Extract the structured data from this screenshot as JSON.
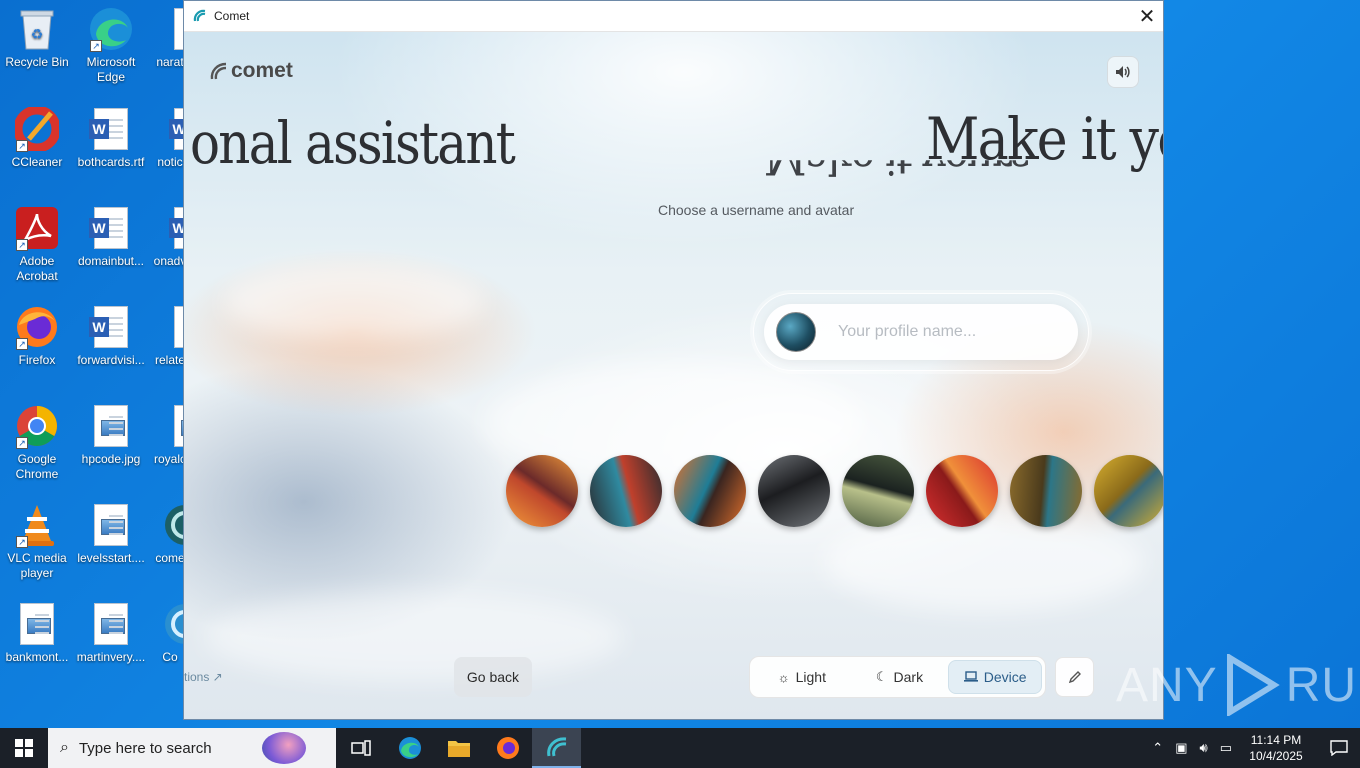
{
  "desktop": {
    "icons": [
      {
        "label": "Recycle Bin",
        "icon": "recycle-bin-icon"
      },
      {
        "label": "Microsoft Edge",
        "icon": "edge-icon"
      },
      {
        "label": "narat",
        "icon": "document-icon"
      },
      {
        "label": "CCleaner",
        "icon": "ccleaner-icon"
      },
      {
        "label": "bothcards.rtf",
        "icon": "word-document-icon"
      },
      {
        "label": "notic",
        "icon": "word-document-icon"
      },
      {
        "label": "Adobe Acrobat",
        "icon": "acrobat-icon"
      },
      {
        "label": "domainbut...",
        "icon": "word-document-icon"
      },
      {
        "label": "onadv",
        "icon": "word-document-icon"
      },
      {
        "label": "Firefox",
        "icon": "firefox-icon"
      },
      {
        "label": "forwardvisi...",
        "icon": "word-document-icon"
      },
      {
        "label": "relate",
        "icon": "document-icon"
      },
      {
        "label": "Google Chrome",
        "icon": "chrome-icon"
      },
      {
        "label": "hpcode.jpg",
        "icon": "image-file-icon"
      },
      {
        "label": "royalc",
        "icon": "image-file-icon"
      },
      {
        "label": "VLC media player",
        "icon": "vlc-icon"
      },
      {
        "label": "levelsstart....",
        "icon": "image-file-icon"
      },
      {
        "label": "come",
        "icon": "comet-icon"
      },
      {
        "label": "bankmont...",
        "icon": "image-file-icon"
      },
      {
        "label": "martinvery....",
        "icon": "image-file-icon"
      },
      {
        "label": "Co",
        "icon": "comet-icon"
      }
    ]
  },
  "window": {
    "title": "Comet",
    "close_label": "✕"
  },
  "app": {
    "logo_text": "comet",
    "marquee_left": "onal assistant",
    "marquee_right_ghost": "Make it yours",
    "marquee_right": "Make it yo",
    "subtitle": "Choose a username and avatar",
    "profile_placeholder": "Your profile name...",
    "avatars": [
      {
        "name": "avatar-orange-red",
        "colors": [
          "#f29a3a",
          "#c0482c",
          "#6b2a2a"
        ]
      },
      {
        "name": "avatar-dark-teal-red",
        "colors": [
          "#2a2c30",
          "#2f8aa0",
          "#c0402c"
        ]
      },
      {
        "name": "avatar-orange-teal",
        "colors": [
          "#e0702c",
          "#1f7d96",
          "#3a2520"
        ]
      },
      {
        "name": "avatar-dark-grey",
        "colors": [
          "#6f7378",
          "#1c1d20",
          "#2b2d30"
        ]
      },
      {
        "name": "avatar-olive-dark",
        "colors": [
          "#4b5b40",
          "#1b2220",
          "#b8c08a"
        ]
      },
      {
        "name": "avatar-red-orange",
        "colors": [
          "#d93030",
          "#f0903a",
          "#8a1a1a"
        ]
      },
      {
        "name": "avatar-olive-brown",
        "colors": [
          "#8a6b2c",
          "#2c7688",
          "#4a3a1c"
        ]
      },
      {
        "name": "avatar-gold-slate",
        "colors": [
          "#d8b030",
          "#3a6a7a",
          "#8a6a1a"
        ]
      }
    ],
    "go_back_label": "Go back",
    "options_link": "tions ↗",
    "theme": {
      "light_label": "Light",
      "dark_label": "Dark",
      "device_label": "Device",
      "selected": "Device"
    }
  },
  "watermark": {
    "text_left": "ANY",
    "text_right": "RUN"
  },
  "taskbar": {
    "search_placeholder": "Type here to search",
    "apps": [
      "task-view",
      "edge",
      "file-explorer",
      "firefox",
      "comet"
    ],
    "clock_time": "11:14 PM",
    "clock_date": "10/4/2025"
  },
  "colors": {
    "desktop_bg": "#0f7ad8",
    "taskbar_bg": "#1b2028",
    "theme_selected_bg": "#e3eef5",
    "theme_selected_text": "#2b5d89"
  }
}
